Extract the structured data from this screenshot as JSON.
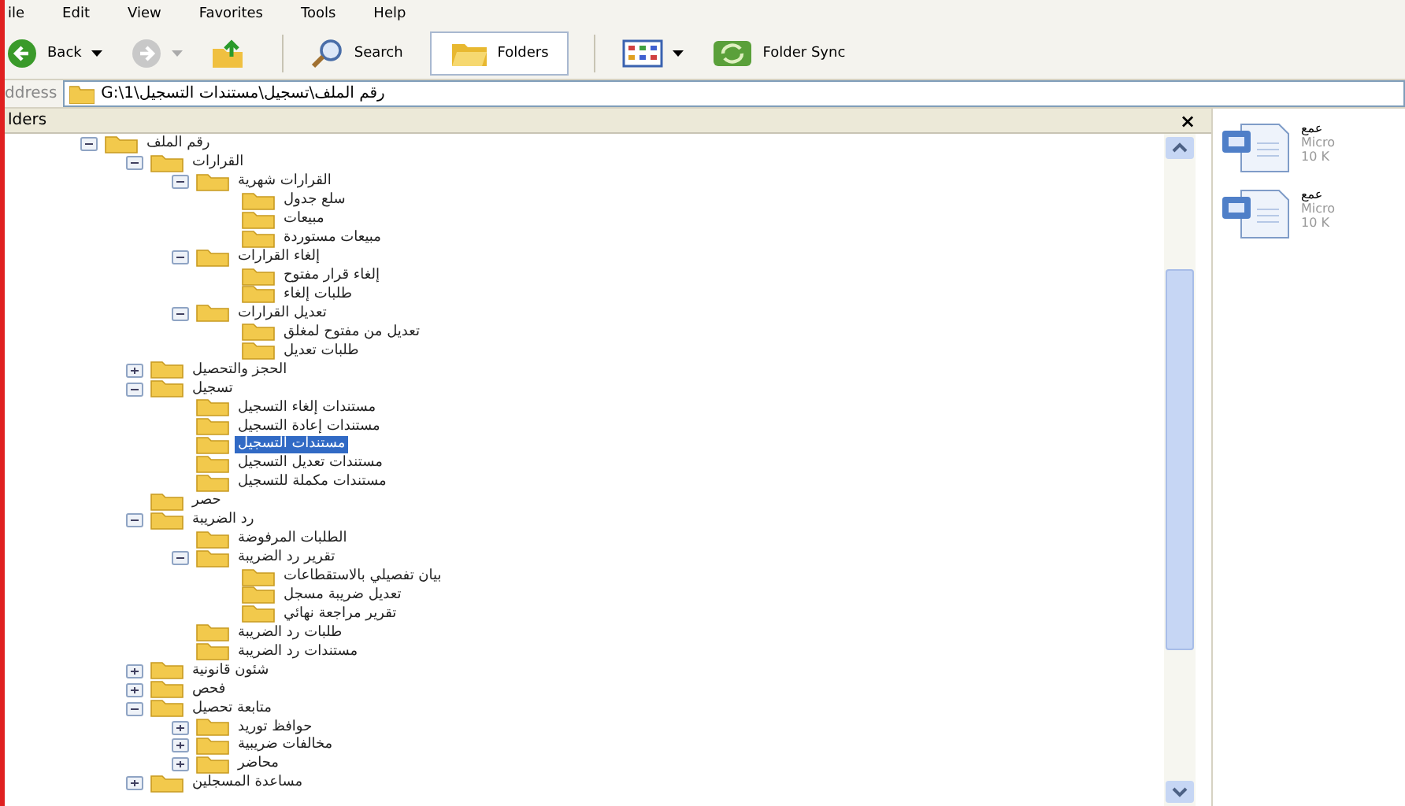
{
  "menu": {
    "file": "ile",
    "edit": "Edit",
    "view": "View",
    "favorites": "Favorites",
    "tools": "Tools",
    "help": "Help"
  },
  "toolbar": {
    "back": {
      "label": "Back",
      "selected": false
    },
    "forward": {
      "selected": false
    },
    "up": {
      "selected": false
    },
    "search": {
      "label": "Search",
      "selected": false
    },
    "folders": {
      "label": "Folders",
      "selected": true
    },
    "views": {
      "selected": false
    },
    "sync": {
      "label": "Folder Sync",
      "selected": false
    }
  },
  "address": {
    "label": "ddress",
    "value": "G:\\1\\رقم الملف\\تسجيل\\مستندات التسجيل"
  },
  "folders_pane": {
    "title": "lders",
    "close": "×",
    "tree": [
      {
        "label": "رقم الملف",
        "expanded": true,
        "selected": false,
        "children": [
          {
            "label": "القرارات",
            "expanded": true,
            "selected": false,
            "children": [
              {
                "label": "القرارات شهرية",
                "expanded": true,
                "selected": false,
                "children": [
                  {
                    "label": "سلع جدول",
                    "selected": false
                  },
                  {
                    "label": "مبيعات",
                    "selected": false
                  },
                  {
                    "label": "مبيعات مستوردة",
                    "selected": false
                  }
                ]
              },
              {
                "label": "إلغاء القرارات",
                "expanded": true,
                "selected": false,
                "children": [
                  {
                    "label": "إلغاء قرار مفتوح",
                    "selected": false
                  },
                  {
                    "label": "طلبات إلغاء",
                    "selected": false
                  }
                ]
              },
              {
                "label": "تعديل القرارات",
                "expanded": true,
                "selected": false,
                "children": [
                  {
                    "label": "تعديل من مفتوح لمغلق",
                    "selected": false
                  },
                  {
                    "label": "طلبات تعديل",
                    "selected": false
                  }
                ]
              }
            ]
          },
          {
            "label": "الحجز والتحصيل",
            "expanded": false,
            "selected": false
          },
          {
            "label": "تسجيل",
            "expanded": true,
            "selected": false,
            "children": [
              {
                "label": "مستندات إلغاء التسجيل",
                "selected": false
              },
              {
                "label": "مستندات إعادة التسجيل",
                "selected": false
              },
              {
                "label": "مستندات التسجيل",
                "selected": true
              },
              {
                "label": "مستندات تعديل التسجيل",
                "selected": false
              },
              {
                "label": "مستندات مكملة للتسجيل",
                "selected": false
              }
            ]
          },
          {
            "label": "حصر",
            "selected": false
          },
          {
            "label": "رد الضريبة",
            "expanded": true,
            "selected": false,
            "children": [
              {
                "label": "الطلبات المرفوضة",
                "selected": false
              },
              {
                "label": "تقرير رد الضريبة",
                "expanded": true,
                "selected": false,
                "children": [
                  {
                    "label": "بيان تفصيلي بالاستقطاعات",
                    "selected": false
                  },
                  {
                    "label": "تعديل ضريبة مسجل",
                    "selected": false
                  },
                  {
                    "label": "تقرير مراجعة نهائي",
                    "selected": false
                  }
                ]
              },
              {
                "label": "طلبات رد الضريبة",
                "selected": false
              },
              {
                "label": "مستندات رد الضريبة",
                "selected": false
              }
            ]
          },
          {
            "label": "شئون قانونية",
            "expanded": false,
            "selected": false
          },
          {
            "label": "فحص",
            "expanded": false,
            "selected": false
          },
          {
            "label": "متابعة تحصيل",
            "expanded": true,
            "selected": false,
            "children": [
              {
                "label": "حوافظ توريد",
                "expanded": false,
                "selected": false
              },
              {
                "label": "مخالفات ضريبية",
                "expanded": false,
                "selected": false
              },
              {
                "label": "محاضر",
                "expanded": false,
                "selected": false
              }
            ]
          },
          {
            "label": "مساعدة المسجلين",
            "expanded": false,
            "selected": false
          }
        ]
      }
    ]
  },
  "files": [
    {
      "name": "عمع",
      "type": "Micro",
      "size": "10 K"
    },
    {
      "name": "عمع",
      "type": "Micro",
      "size": "10 K"
    }
  ]
}
